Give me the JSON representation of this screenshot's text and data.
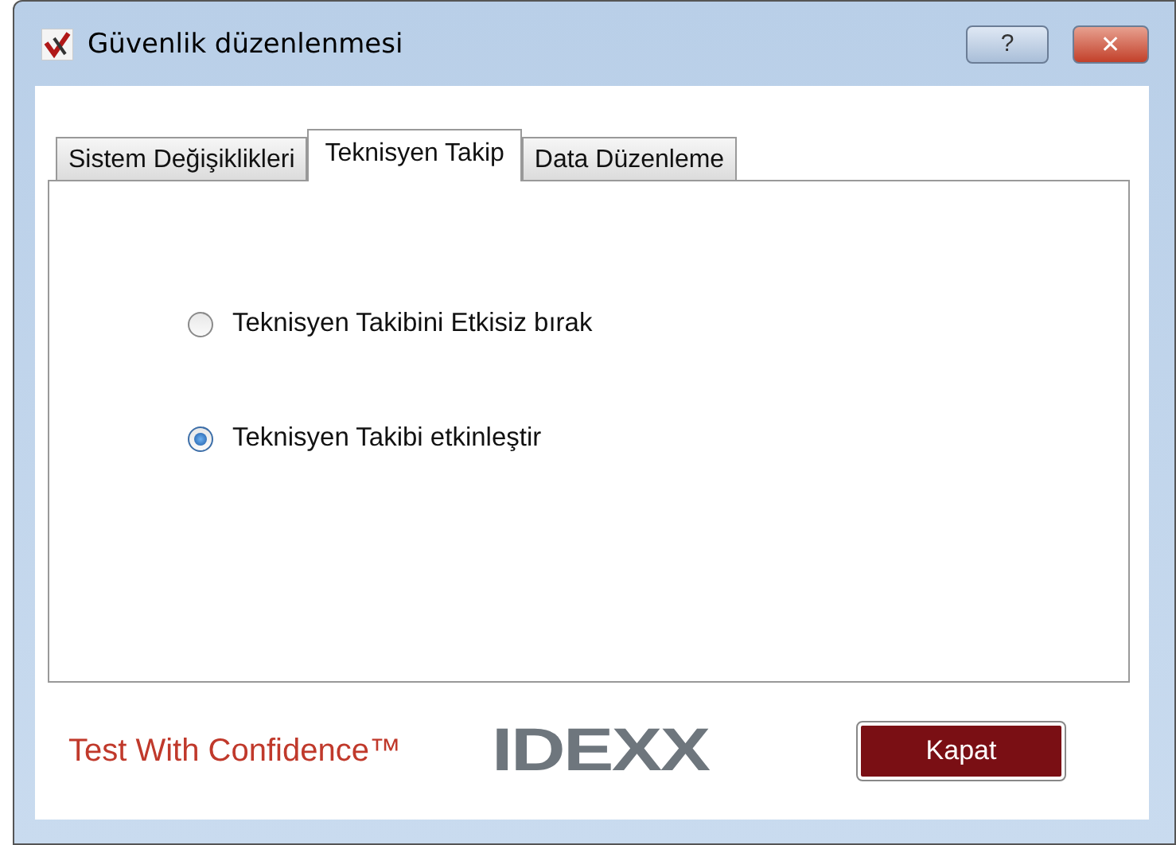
{
  "window": {
    "title": "Güvenlik düzenlenmesi",
    "help_button": "?",
    "close_button": "✕"
  },
  "tabs": [
    {
      "label": "Sistem Değişiklikleri",
      "selected": false
    },
    {
      "label": "Teknisyen Takip",
      "selected": true
    },
    {
      "label": "Data Düzenleme",
      "selected": false
    }
  ],
  "options": [
    {
      "label": "Teknisyen Takibini Etkisiz bırak",
      "selected": false
    },
    {
      "label": "Teknisyen Takibi etkinleştir",
      "selected": true
    }
  ],
  "footer": {
    "slogan": "Test With Confidence™",
    "logo": "IDEXX",
    "close": "Kapat"
  }
}
